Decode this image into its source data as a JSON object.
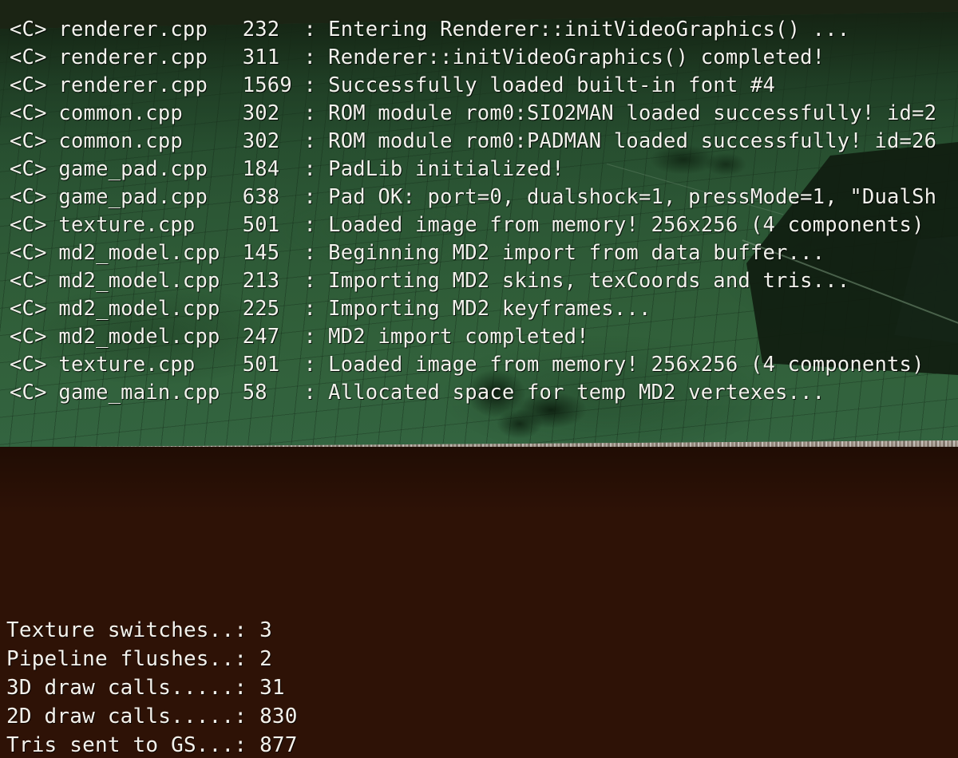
{
  "scene": {
    "description": "realtime-3d-engine-debug-overlay",
    "colors": {
      "floor_green": "#2b5534",
      "void_dark_green": "#1b2414",
      "ground_brown": "#2e1206",
      "floor_edge_stone": "#8f857b",
      "overlay_text": "#f2f2ec"
    }
  },
  "log": {
    "lines": [
      {
        "tag": "<C>",
        "file": "renderer.cpp",
        "line": "232",
        "sep": ":",
        "message": "Entering Renderer::initVideoGraphics() ..."
      },
      {
        "tag": "<C>",
        "file": "renderer.cpp",
        "line": "311",
        "sep": ":",
        "message": "Renderer::initVideoGraphics() completed!"
      },
      {
        "tag": "<C>",
        "file": "renderer.cpp",
        "line": "1569",
        "sep": ":",
        "message": "Successfully loaded built-in font #4"
      },
      {
        "tag": "<C>",
        "file": "common.cpp",
        "line": "302",
        "sep": ":",
        "message": "ROM module rom0:SIO2MAN loaded successfully! id=2"
      },
      {
        "tag": "<C>",
        "file": "common.cpp",
        "line": "302",
        "sep": ":",
        "message": "ROM module rom0:PADMAN loaded successfully! id=26"
      },
      {
        "tag": "<C>",
        "file": "game_pad.cpp",
        "line": "184",
        "sep": ":",
        "message": "PadLib initialized!"
      },
      {
        "tag": "<C>",
        "file": "game_pad.cpp",
        "line": "638",
        "sep": ":",
        "message": "Pad OK: port=0, dualshock=1, pressMode=1, \"DualSh"
      },
      {
        "tag": "<C>",
        "file": "texture.cpp",
        "line": "501",
        "sep": ":",
        "message": "Loaded image from memory! 256x256 (4 components)"
      },
      {
        "tag": "<C>",
        "file": "md2_model.cpp",
        "line": "145",
        "sep": ":",
        "message": "Beginning MD2 import from data buffer..."
      },
      {
        "tag": "<C>",
        "file": "md2_model.cpp",
        "line": "213",
        "sep": ":",
        "message": "Importing MD2 skins, texCoords and tris..."
      },
      {
        "tag": "<C>",
        "file": "md2_model.cpp",
        "line": "225",
        "sep": ":",
        "message": "Importing MD2 keyframes..."
      },
      {
        "tag": "<C>",
        "file": "md2_model.cpp",
        "line": "247",
        "sep": ":",
        "message": "MD2 import completed!"
      },
      {
        "tag": "<C>",
        "file": "texture.cpp",
        "line": "501",
        "sep": ":",
        "message": "Loaded image from memory! 256x256 (4 components)"
      },
      {
        "tag": "<C>",
        "file": "game_main.cpp",
        "line": "58",
        "sep": ":",
        "message": "Allocated space for temp MD2 vertexes..."
      }
    ]
  },
  "stats": {
    "rows": [
      {
        "label": "Texture switches..: ",
        "value": "3"
      },
      {
        "label": "Pipeline flushes..: ",
        "value": "2"
      },
      {
        "label": "3D draw calls.....: ",
        "value": "31"
      },
      {
        "label": "2D draw calls.....: ",
        "value": "830"
      },
      {
        "label": "Tris sent to GS...: ",
        "value": "877"
      }
    ]
  }
}
